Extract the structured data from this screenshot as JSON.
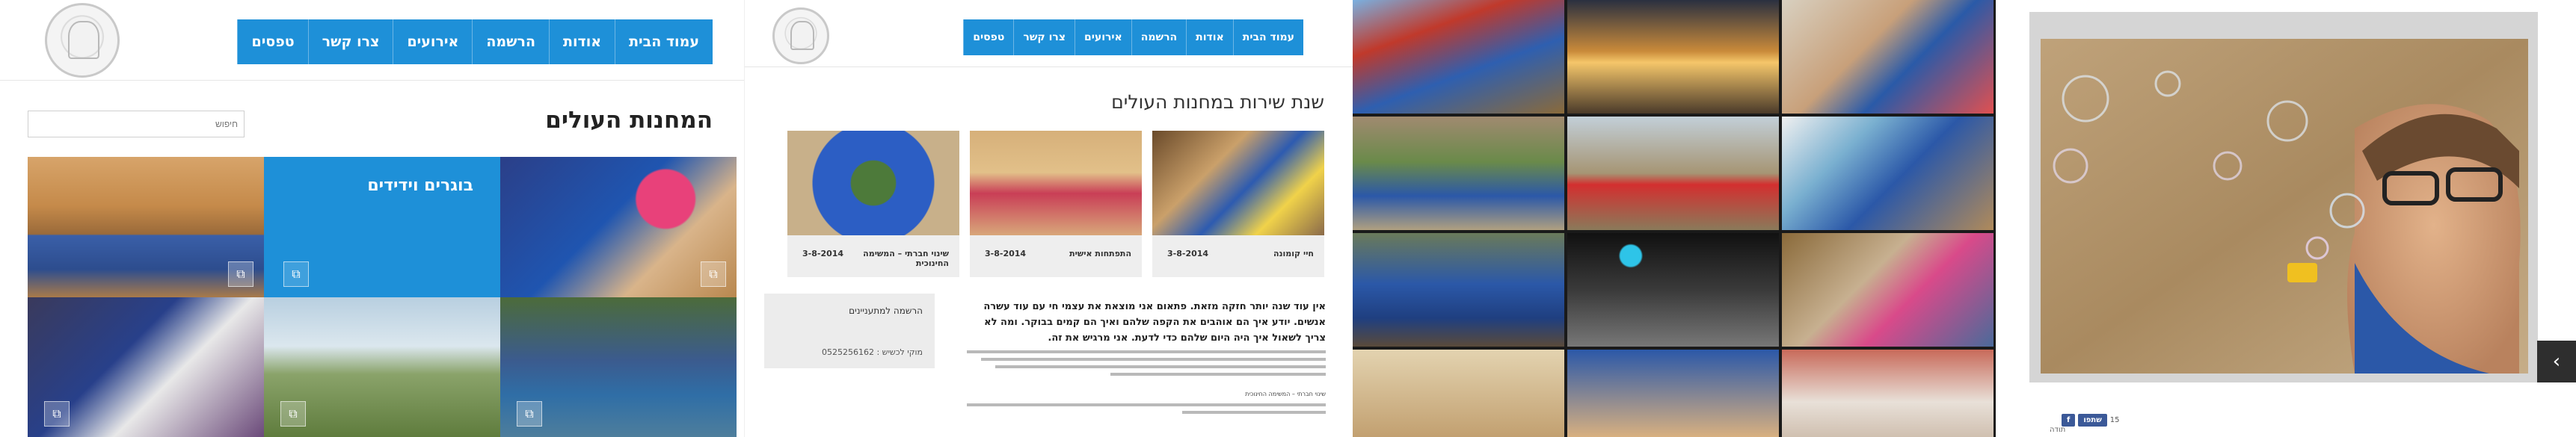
{
  "site": {
    "nav": [
      "עמוד הבית",
      "אודות",
      "הרשמה",
      "אירועים",
      "צרו קשר",
      "טפסים"
    ]
  },
  "page1": {
    "title": "המחנות העולים",
    "search_placeholder": "חיפוש",
    "tiles": {
      "blue_title": "בוגרים וידידים"
    }
  },
  "page2": {
    "title": "שנת שירות במחנות העולים",
    "cards": [
      {
        "title": "חיי קומונה",
        "date": "3-8-2014"
      },
      {
        "title": "התפתחות אישית",
        "date": "3-8-2014"
      },
      {
        "title": "שינוי חברתי – המשימה החינוכית",
        "date": "3-8-2014"
      }
    ],
    "side_box": {
      "title": "הרשמה למתעניינים",
      "phone": "מוקי לכשיש : 0525256162"
    },
    "lead": "אין עוד שנה יותר חזקה מזאת. פתאום אני מוצאת את עצמי חי עם עוד עשרה אנשים. יודע איך הם אוהבים את הקפה שלהם ואיך הם קמים בבוקר. ומה לא צריך לשאול איך היה היום שלהם כדי לדעת. אני מרגיש את זה.",
    "sub_heading": "שינוי חברתי – המשימה החינוכית"
  },
  "page4": {
    "share_label": "שתפו",
    "fb_count": "15",
    "ref_text": "תודה"
  }
}
